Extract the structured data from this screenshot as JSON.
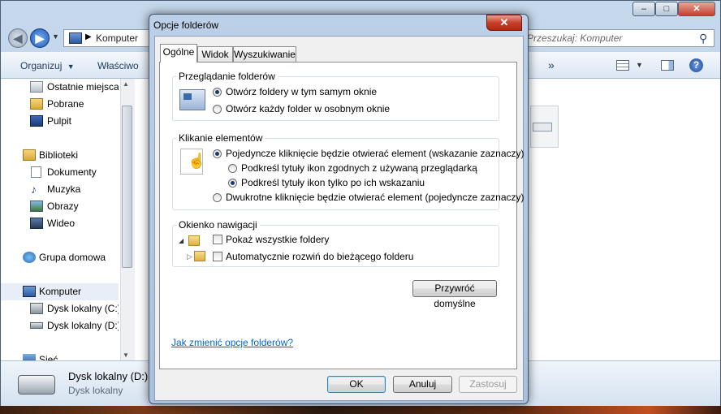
{
  "explorer": {
    "address": "Komputer",
    "search_placeholder": "Przeszukaj: Komputer",
    "toolbar": {
      "organize": "Organizuj",
      "properties": "Właściwo",
      "more": "»"
    },
    "nav_items": [
      {
        "label": "Ostatnie miejsca",
        "icon": "recent-places-icon"
      },
      {
        "label": "Pobrane",
        "icon": "downloads-folder-icon"
      },
      {
        "label": "Pulpit",
        "icon": "desktop-icon"
      },
      {
        "label": "Biblioteki",
        "icon": "libraries-icon"
      },
      {
        "label": "Dokumenty",
        "icon": "documents-icon"
      },
      {
        "label": "Muzyka",
        "icon": "music-icon"
      },
      {
        "label": "Obrazy",
        "icon": "pictures-icon"
      },
      {
        "label": "Wideo",
        "icon": "videos-icon"
      },
      {
        "label": "Grupa domowa",
        "icon": "homegroup-icon"
      },
      {
        "label": "Komputer",
        "icon": "computer-icon"
      },
      {
        "label": "Dysk lokalny (C:)",
        "icon": "drive-c-icon"
      },
      {
        "label": "Dysk lokalny (D:)",
        "icon": "drive-d-icon"
      },
      {
        "label": "Sieć",
        "icon": "network-icon"
      }
    ],
    "details": {
      "name": "Dysk lokalny (D:)",
      "type": "Dysk lokalny"
    }
  },
  "dialog": {
    "title": "Opcje folderów",
    "close": "✕",
    "tabs": [
      "Ogólne",
      "Widok",
      "Wyszukiwanie"
    ],
    "browse": {
      "legend": "Przeglądanie folderów",
      "opt_same": "Otwórz foldery w tym samym oknie",
      "opt_new": "Otwórz każdy folder w osobnym oknie",
      "selected": "same"
    },
    "click": {
      "legend": "Klikanie elementów",
      "opt_single": "Pojedyncze kliknięcie będzie otwierać element (wskazanie zaznaczy)",
      "sub_browser": "Podkreśl tytuły ikon zgodnych z używaną przeglądarką",
      "sub_point": "Podkreśl tytuły ikon tylko po ich wskazaniu",
      "opt_double": "Dwukrotne kliknięcie będzie otwierać element (pojedyncze zaznaczy)",
      "selected": "single",
      "sub_selected": "point"
    },
    "nav": {
      "legend": "Okienko nawigacji",
      "show_all": "Pokaż wszystkie foldery",
      "auto_expand": "Automatycznie rozwiń do bieżącego folderu",
      "show_all_checked": false,
      "auto_expand_checked": false
    },
    "restore_defaults": "Przywróć domyślne",
    "help_link": "Jak zmienić opcje folderów?",
    "ok": "OK",
    "cancel": "Anuluj",
    "apply": "Zastosuj"
  }
}
